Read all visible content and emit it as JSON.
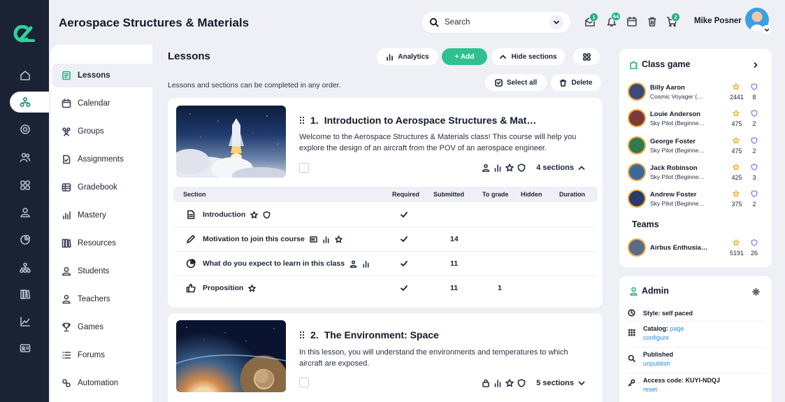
{
  "app": {
    "title": "Aerospace Structures & Materials"
  },
  "search": {
    "placeholder": "Search"
  },
  "badges": {
    "messages": "1",
    "notifications": "64",
    "cart": "2"
  },
  "user": {
    "name": "Mike Posner"
  },
  "menu": {
    "items": [
      {
        "label": "Lessons",
        "icon": "book-icon",
        "active": true
      },
      {
        "label": "Calendar",
        "icon": "calendar-icon"
      },
      {
        "label": "Groups",
        "icon": "groups-icon"
      },
      {
        "label": "Assignments",
        "icon": "assignment-icon"
      },
      {
        "label": "Gradebook",
        "icon": "gradebook-icon"
      },
      {
        "label": "Mastery",
        "icon": "mastery-icon"
      },
      {
        "label": "Resources",
        "icon": "resources-icon"
      },
      {
        "label": "Students",
        "icon": "student-icon"
      },
      {
        "label": "Teachers",
        "icon": "teacher-icon"
      },
      {
        "label": "Games",
        "icon": "trophy-icon"
      },
      {
        "label": "Forums",
        "icon": "forum-icon"
      },
      {
        "label": "Automation",
        "icon": "automation-icon"
      }
    ]
  },
  "lessons": {
    "title": "Lessons",
    "subtitle": "Lessons and sections can be completed in any order.",
    "analytics_label": "Analytics",
    "add_label": "+ Add",
    "hide_sections_label": "Hide sections",
    "select_all_label": "Select all",
    "delete_label": "Delete",
    "table_headers": {
      "section": "Section",
      "required": "Required",
      "submitted": "Submitted",
      "to_grade": "To grade",
      "hidden": "Hidden",
      "duration": "Duration"
    },
    "items": [
      {
        "number": "1.",
        "title": "Introduction to Aerospace Structures & Mat…",
        "description": "Welcome to the Aerospace Structures & Materials class! This course will help you explore the design of an aircraft from the POV of an aerospace engineer.",
        "sections_label": "4 sections",
        "sections": [
          {
            "title": "Introduction",
            "required": true,
            "submitted": "",
            "to_grade": ""
          },
          {
            "title": "Motivation to join this course",
            "required": true,
            "submitted": "14",
            "to_grade": ""
          },
          {
            "title": "What do you expect to learn in this class",
            "required": true,
            "submitted": "11",
            "to_grade": ""
          },
          {
            "title": "Proposition",
            "required": true,
            "submitted": "11",
            "to_grade": "1"
          }
        ]
      },
      {
        "number": "2.",
        "title": "The Environment: Space",
        "description": "In this lesson, you will understand the environments and temperatures to which aircraft are exposed.",
        "sections_label": "5 sections"
      }
    ]
  },
  "class_game": {
    "title": "Class game",
    "players": [
      {
        "name": "Billy Aaron",
        "level": "Cosmic Voyager (…",
        "points": "2441",
        "count": "8",
        "avatar_color": "#3b4a7a"
      },
      {
        "name": "Louie Anderson",
        "level": "Sky Pilot (Beginne…",
        "points": "475",
        "count": "2",
        "avatar_color": "#7a3b3b"
      },
      {
        "name": "George Foster",
        "level": "Sky Pilot (Beginne…",
        "points": "475",
        "count": "2",
        "avatar_color": "#2f7a55"
      },
      {
        "name": "Jack Robinson",
        "level": "Sky Pilot (Beginne…",
        "points": "425",
        "count": "3",
        "avatar_color": "#3b6a9a"
      },
      {
        "name": "Andrew Foster",
        "level": "Sky Pilot (Beginne…",
        "points": "375",
        "count": "2",
        "avatar_color": "#2a3a6a"
      }
    ],
    "teams_title": "Teams",
    "teams": [
      {
        "name": "Airbus Enthusia…",
        "points": "5191",
        "count": "26",
        "avatar_color": "#5a6b8a"
      }
    ]
  },
  "admin": {
    "title": "Admin",
    "style": "Style: self paced",
    "catalog_label": "Catalog:",
    "catalog_link": "page",
    "catalog_link2": "configure",
    "published_label": "Published",
    "unpublish_link": "unpublish",
    "access_code": "Access code: KUYI-NDQJ",
    "reset_link": "reset"
  },
  "colors": {
    "accent": "#21b07f",
    "rail": "#1a2233",
    "link": "#2b8fd6"
  }
}
